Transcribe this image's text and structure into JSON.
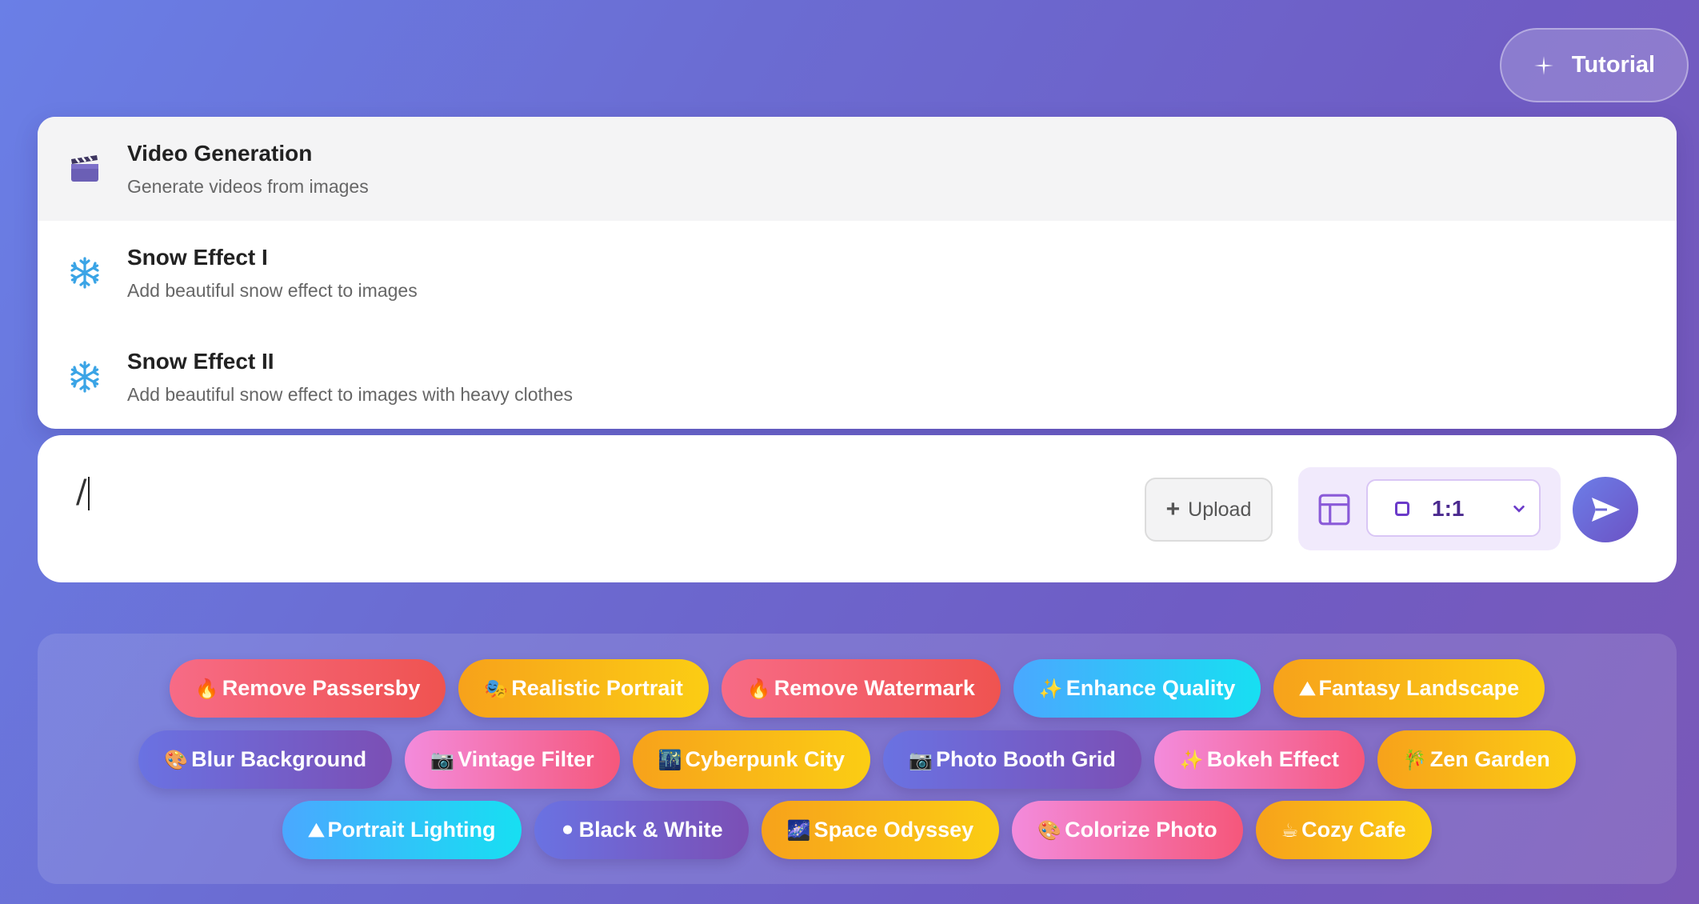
{
  "tutorial": {
    "label": "Tutorial"
  },
  "dropdown": {
    "items": [
      {
        "title": "Video Generation",
        "description": "Generate videos from images",
        "icon": "clapperboard-icon",
        "active": true
      },
      {
        "title": "Snow Effect I",
        "description": "Add beautiful snow effect to images",
        "icon": "snowflake-icon",
        "active": false
      },
      {
        "title": "Snow Effect II",
        "description": "Add beautiful snow effect to images with heavy clothes",
        "icon": "snowflake-icon",
        "active": false
      }
    ]
  },
  "input": {
    "value": "/"
  },
  "upload": {
    "label": "Upload"
  },
  "aspect": {
    "value": "1:1"
  },
  "chips": [
    {
      "emoji": "🔥",
      "label": "Remove Passersby",
      "style": "red"
    },
    {
      "emoji": "🎭",
      "label": "Realistic Portrait",
      "style": "orange"
    },
    {
      "emoji": "🔥",
      "label": "Remove Watermark",
      "style": "red"
    },
    {
      "emoji": "✨",
      "label": "Enhance Quality",
      "style": "cyan"
    },
    {
      "emoji": "⛰",
      "label": "Fantasy Landscape",
      "style": "orange"
    },
    {
      "emoji": "🎨",
      "label": "Blur Background",
      "style": "purple"
    },
    {
      "emoji": "📷",
      "label": "Vintage Filter",
      "style": "pink"
    },
    {
      "emoji": "🌃",
      "label": "Cyberpunk City",
      "style": "orange"
    },
    {
      "emoji": "📷",
      "label": "Photo Booth Grid",
      "style": "purple"
    },
    {
      "emoji": "✨",
      "label": "Bokeh Effect",
      "style": "pink"
    },
    {
      "emoji": "🎋",
      "label": "Zen Garden",
      "style": "orange"
    },
    {
      "emoji": "⛰",
      "label": "Portrait Lighting",
      "style": "cyan"
    },
    {
      "emoji": "⚫",
      "label": "Black & White",
      "style": "purple"
    },
    {
      "emoji": "🌌",
      "label": "Space Odyssey",
      "style": "orange"
    },
    {
      "emoji": "🎨",
      "label": "Colorize Photo",
      "style": "pink"
    },
    {
      "emoji": "☕",
      "label": "Cozy Cafe",
      "style": "orange"
    }
  ]
}
